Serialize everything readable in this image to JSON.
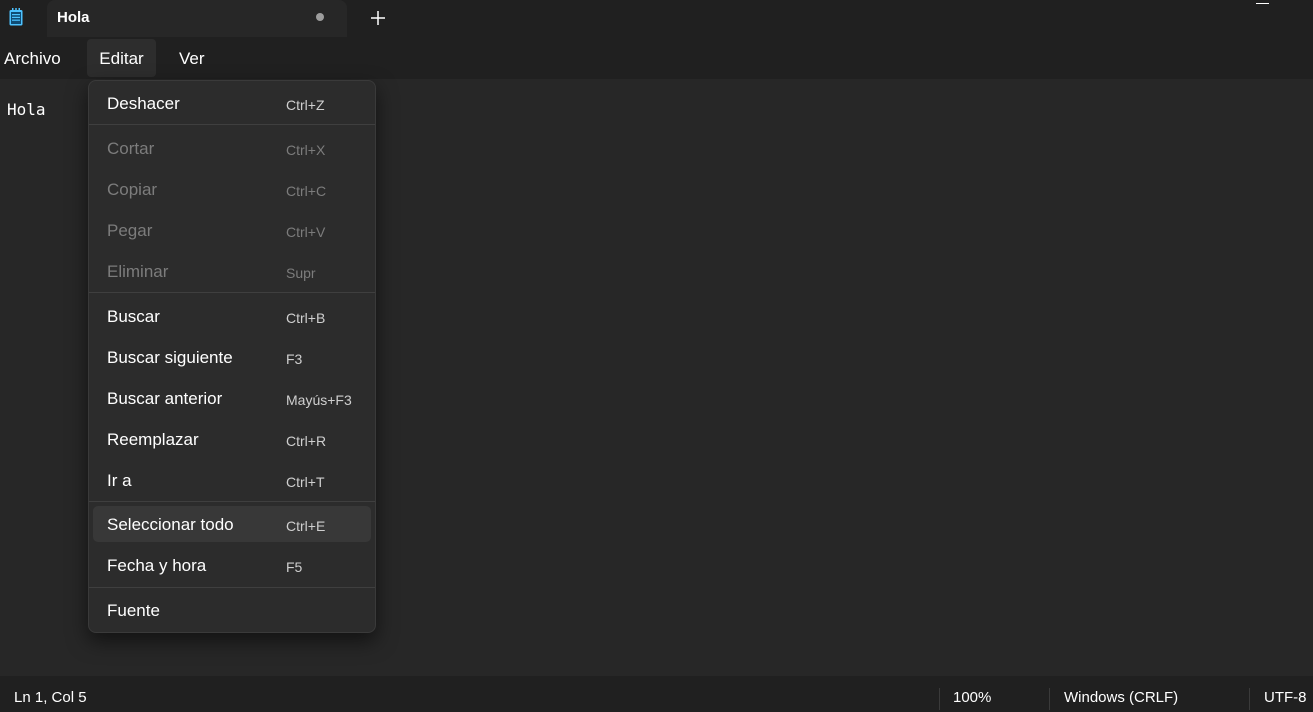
{
  "tab": {
    "title": "Hola",
    "unsaved_indicator": "dot"
  },
  "menubar": {
    "items": [
      {
        "label": "Archivo"
      },
      {
        "label": "Editar"
      },
      {
        "label": "Ver"
      }
    ],
    "active": "Editar"
  },
  "editor": {
    "content": "Hola"
  },
  "edit_menu": {
    "groups": [
      {
        "items": [
          {
            "label": "Deshacer",
            "shortcut": "Ctrl+Z",
            "enabled": true
          }
        ]
      },
      {
        "items": [
          {
            "label": "Cortar",
            "shortcut": "Ctrl+X",
            "enabled": false
          },
          {
            "label": "Copiar",
            "shortcut": "Ctrl+C",
            "enabled": false
          },
          {
            "label": "Pegar",
            "shortcut": "Ctrl+V",
            "enabled": false
          },
          {
            "label": "Eliminar",
            "shortcut": "Supr",
            "enabled": false
          }
        ]
      },
      {
        "items": [
          {
            "label": "Buscar",
            "shortcut": "Ctrl+B",
            "enabled": true
          },
          {
            "label": "Buscar siguiente",
            "shortcut": "F3",
            "enabled": true
          },
          {
            "label": "Buscar anterior",
            "shortcut": "Mayús+F3",
            "enabled": true
          },
          {
            "label": "Reemplazar",
            "shortcut": "Ctrl+R",
            "enabled": true
          },
          {
            "label": "Ir a",
            "shortcut": "Ctrl+T",
            "enabled": true
          }
        ]
      },
      {
        "items": [
          {
            "label": "Seleccionar todo",
            "shortcut": "Ctrl+E",
            "enabled": true,
            "highlighted": true
          },
          {
            "label": "Fecha y hora",
            "shortcut": "F5",
            "enabled": true
          }
        ]
      },
      {
        "items": [
          {
            "label": "Fuente",
            "shortcut": "",
            "enabled": true
          }
        ]
      }
    ]
  },
  "statusbar": {
    "position": "Ln 1, Col 5",
    "zoom": "100%",
    "line_ending": "Windows (CRLF)",
    "encoding": "UTF-8"
  },
  "colors": {
    "background": "#272727",
    "chrome": "#202020",
    "menu_background": "#2c2c2c",
    "highlight": "#383838",
    "disabled_text": "#7c7c7c",
    "icon_accent": "#4cc2ff"
  }
}
